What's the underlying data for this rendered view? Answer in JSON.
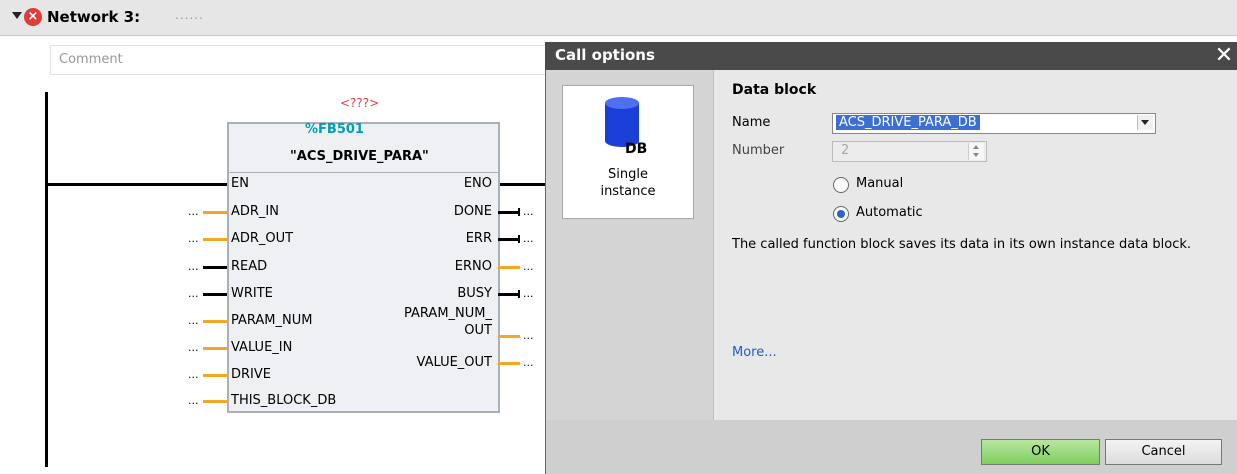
{
  "network": {
    "title": "Network 3:",
    "title_dots": "......",
    "comment_placeholder": "Comment"
  },
  "block": {
    "unassigned_instance": "<???>",
    "number": "%FB501",
    "name": "\"ACS_DRIVE_PARA\"",
    "inputs": [
      "EN",
      "ADR_IN",
      "ADR_OUT",
      "READ",
      "WRITE",
      "PARAM_NUM",
      "VALUE_IN",
      "DRIVE",
      "THIS_BLOCK_DB"
    ],
    "outputs": [
      "ENO",
      "DONE",
      "ERR",
      "ERNO",
      "BUSY",
      "PARAM_NUM_",
      "OUT",
      "VALUE_OUT"
    ],
    "placeholder": "..."
  },
  "dialog": {
    "title": "Call options",
    "close": "✕",
    "tile": {
      "icon_text": "DB",
      "label_line1": "Single",
      "label_line2": "instance"
    },
    "section_title": "Data block",
    "name_label": "Name",
    "name_value": "ACS_DRIVE_PARA_DB",
    "number_label": "Number",
    "number_value": "2",
    "radio_manual": "Manual",
    "radio_automatic": "Automatic",
    "selected_mode": "Automatic",
    "description": "The called function block saves its data in its own instance data block.",
    "more_link": "More...",
    "ok": "OK",
    "cancel": "Cancel"
  },
  "colors": {
    "wire_orange": "#f5a623",
    "error_red": "#e03a3a",
    "fb_number": "#00a0b0",
    "ok_green": "#7fcf5c",
    "link_blue": "#1f5fc7"
  }
}
